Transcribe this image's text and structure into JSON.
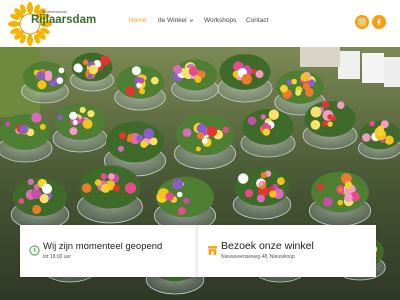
{
  "header": {
    "logo": {
      "tagline": "Bloemenwinkel",
      "brand": "Rijlaarsdam"
    },
    "nav": [
      {
        "label": "Home",
        "active": true
      },
      {
        "label": "de Winkel",
        "has_dropdown": true
      },
      {
        "label": "Workshops"
      },
      {
        "label": "Contact"
      }
    ],
    "social": [
      {
        "icon": "instagram-icon"
      },
      {
        "icon": "facebook-icon"
      }
    ]
  },
  "colors": {
    "accent": "#f5a012",
    "brand_green": "#3a6d2f",
    "open_icon": "#4cae4f"
  },
  "cards": {
    "open": {
      "title": "Wij zijn momenteel geopend",
      "subtitle": "tot 18:00 uur",
      "icon": "clock-icon"
    },
    "visit": {
      "title": "Bezoek onze winkel",
      "subtitle": "Nieuwveenseweg 48, Nieuwkoop",
      "icon": "shop-icon"
    }
  }
}
